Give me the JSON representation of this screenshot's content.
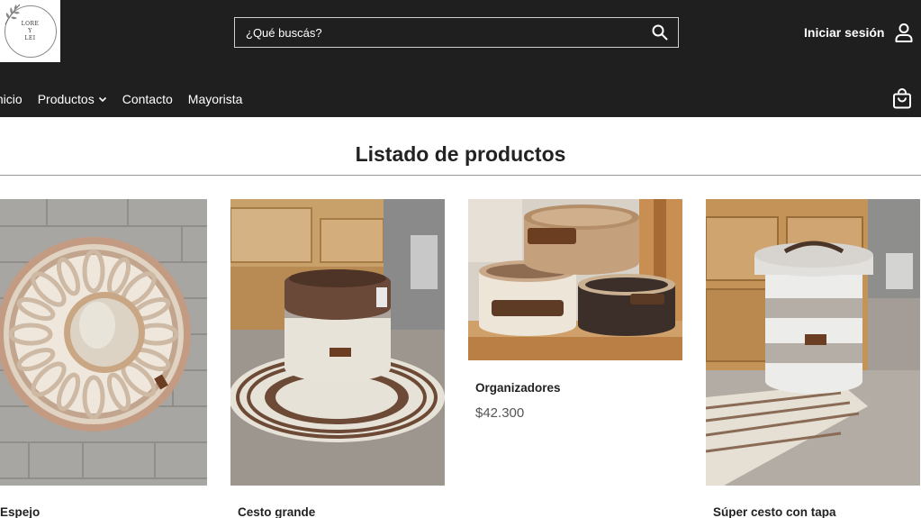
{
  "header": {
    "logo": {
      "line1": "LORE",
      "line2": "Y",
      "line3": "LEI"
    },
    "search_placeholder": "¿Qué buscás?",
    "login_label": "Iniciar sesión",
    "nav": [
      "Inicio",
      "Productos",
      "Contacto",
      "Mayorista"
    ]
  },
  "main": {
    "title": "Listado de productos",
    "products": [
      {
        "name": "Espejo"
      },
      {
        "name": "Cesto grande"
      },
      {
        "name": "Organizadores",
        "price": "$42.300"
      },
      {
        "name": "Súper cesto con tapa"
      }
    ]
  },
  "colors": {
    "header_bg": "#1f1f1f",
    "header_text": "#ffffff",
    "page_bg": "#ffffff"
  },
  "icons": [
    "search-icon",
    "user-icon",
    "chevron-down-icon",
    "shopping-bag-icon"
  ]
}
